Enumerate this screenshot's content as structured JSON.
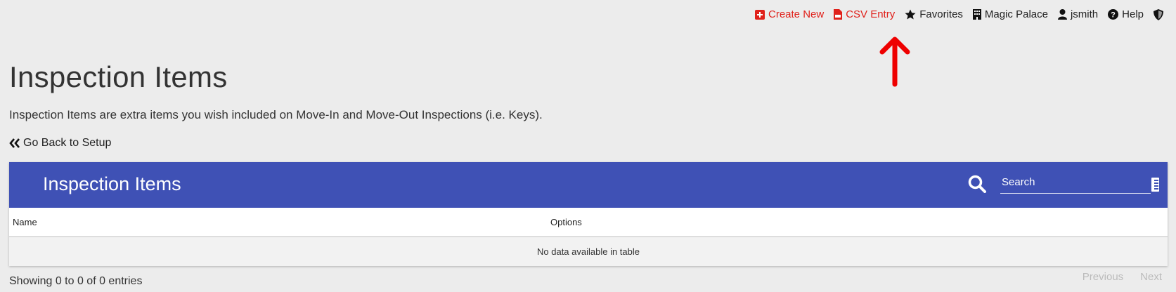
{
  "topnav": {
    "create_new": "Create New",
    "csv_entry": "CSV Entry",
    "favorites": "Favorites",
    "property": "Magic Palace",
    "user": "jsmith",
    "help": "Help",
    "icons": [
      "plus-square-icon",
      "file-csv-icon",
      "star-icon",
      "building-icon",
      "user-icon",
      "question-circle-icon",
      "shield-icon"
    ]
  },
  "page": {
    "title": "Inspection Items",
    "description": "Inspection Items are extra items you wish included on Move-In and Move-Out Inspections (i.e. Keys).",
    "back_link": "Go Back to Setup"
  },
  "card": {
    "title": "Inspection Items",
    "search_placeholder": "Search",
    "columns": [
      "Name",
      "Options"
    ],
    "empty_message": "No data available in table"
  },
  "footer": {
    "info": "Showing 0 to 0 of 0 entries",
    "previous": "Previous",
    "next": "Next"
  },
  "colors": {
    "header_bg": "#3f51b5",
    "accent_red": "#e0211b",
    "page_bg": "#ececec"
  }
}
